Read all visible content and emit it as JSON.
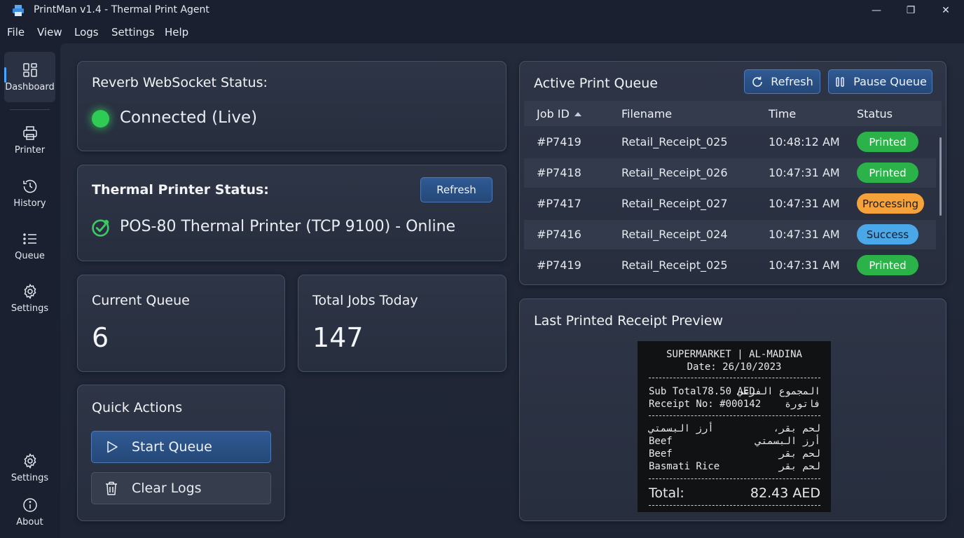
{
  "window": {
    "title": "PrintMan v1.4 - Thermal Print Agent",
    "minimize_glyph": "—",
    "maximize_glyph": "❐",
    "close_glyph": "✕"
  },
  "menu": [
    "File",
    "View",
    "Logs",
    "Settings",
    "Help"
  ],
  "sidebar": {
    "items": [
      {
        "label": "Dashboard",
        "icon": "dashboard-icon"
      },
      {
        "label": "Printer",
        "icon": "printer-icon"
      },
      {
        "label": "History",
        "icon": "history-icon"
      },
      {
        "label": "Queue",
        "icon": "queue-icon"
      },
      {
        "label": "Settings",
        "icon": "settings-icon"
      }
    ],
    "bottom": [
      {
        "label": "Settings",
        "icon": "settings-icon"
      },
      {
        "label": "About",
        "icon": "info-icon"
      }
    ]
  },
  "websocket": {
    "title": "Reverb WebSocket Status:",
    "status": "Connected (Live)",
    "status_color": "#2ecc55"
  },
  "printer": {
    "title": "Thermal Printer Status:",
    "refresh_label": "Refresh",
    "status": "POS-80 Thermal Printer (TCP 9100) - Online"
  },
  "stats": {
    "queue_label": "Current Queue",
    "queue_value": "6",
    "jobs_label": "Total Jobs Today",
    "jobs_value": "147"
  },
  "quick_actions": {
    "title": "Quick Actions",
    "start_label": "Start Queue",
    "clear_label": "Clear Logs"
  },
  "queue": {
    "title": "Active Print Queue",
    "refresh_label": "Refresh",
    "pause_label": "Pause Queue",
    "columns": [
      "Job ID",
      "Filename",
      "Time",
      "Status"
    ],
    "rows": [
      {
        "id": "#P7419",
        "file": "Retail_Receipt_025",
        "time": "10:48:12 AM",
        "status": "Printed",
        "color": "#2bb34a",
        "text_color": "#ffffff"
      },
      {
        "id": "#P7418",
        "file": "Retail_Receipt_026",
        "time": "10:47:31 AM",
        "status": "Printed",
        "color": "#2bb34a",
        "text_color": "#ffffff"
      },
      {
        "id": "#P7417",
        "file": "Retail_Receipt_027",
        "time": "10:47:31 AM",
        "status": "Processing",
        "color": "#f5a23a",
        "text_color": "#1b1b1b"
      },
      {
        "id": "#P7416",
        "file": "Retail_Receipt_024",
        "time": "10:47:31 AM",
        "status": "Success",
        "color": "#4aa8e8",
        "text_color": "#0f1a26"
      },
      {
        "id": "#P7419",
        "file": "Retail_Receipt_025",
        "time": "10:47:31 AM",
        "status": "Printed",
        "color": "#2bb34a",
        "text_color": "#ffffff"
      }
    ]
  },
  "receipt": {
    "title": "Last Printed Receipt Preview",
    "header": "SUPERMARKET | AL-MADINA",
    "date": "Date: 26/10/2023",
    "subtotal_left": "Sub Total78.50 AED",
    "subtotal_right": "المجموع الفرعي",
    "receipt_no_left": "Receipt No: #000142",
    "receipt_no_right": "فاتورة",
    "items": [
      {
        "left": "أرز البسمتي",
        "right": "لحم بقر،"
      },
      {
        "left": "Beef",
        "right": "أرز البسمتي"
      },
      {
        "left": "Beef",
        "right": "لحم بقر"
      },
      {
        "left": "Basmati Rice",
        "right": "لحم بقر"
      }
    ],
    "total_label": "Total:",
    "total_value": "82.43 AED"
  }
}
